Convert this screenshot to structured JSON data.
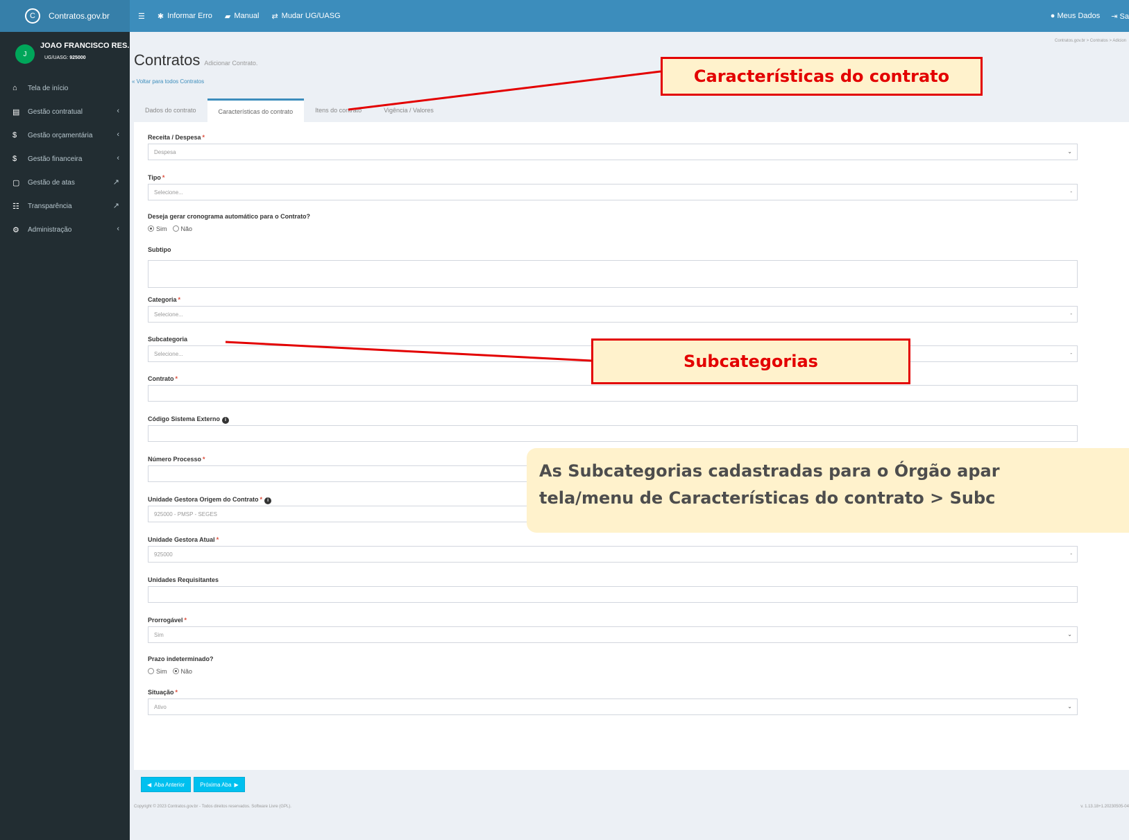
{
  "header": {
    "logo_text": "Contratos.gov.br",
    "nav": [
      "Informar Erro",
      "Manual",
      "Mudar UG/UASG"
    ],
    "meus_dados": "Meus Dados",
    "sair": "Sa"
  },
  "sidebar": {
    "user_name": "JOAO FRANCISCO RES...",
    "user_initial": "J",
    "uasg_label": "UG/UASG:",
    "uasg_value": "925000",
    "items": [
      {
        "label": "Tela de início",
        "icon": "home-icon"
      },
      {
        "label": "Gestão contratual",
        "icon": "document-icon"
      },
      {
        "label": "Gestão orçamentária",
        "icon": "dollar-icon"
      },
      {
        "label": "Gestão financeira",
        "icon": "dollar-icon"
      },
      {
        "label": "Gestão de atas",
        "icon": "file-icon"
      },
      {
        "label": "Transparência",
        "icon": "list-icon"
      },
      {
        "label": "Administração",
        "icon": "cogs-icon"
      }
    ]
  },
  "page": {
    "title": "Contratos",
    "subtitle": "Adicionar Contrato.",
    "back_link": "Voltar para todos Contratos",
    "breadcrumb": "Contratos.gov.br > Contratos > Adicion"
  },
  "tabs": [
    "Dados do contrato",
    "Características do contrato",
    "Itens do contrato",
    "Vigência / Valores"
  ],
  "form": {
    "receita_despesa": {
      "label": "Receita / Despesa",
      "value": "Despesa"
    },
    "tipo": {
      "label": "Tipo",
      "placeholder": "Selecione..."
    },
    "cronograma": {
      "label": "Deseja gerar cronograma automático para o Contrato?",
      "opt1": "Sim",
      "opt2": "Não"
    },
    "subtipo": {
      "label": "Subtipo"
    },
    "categoria": {
      "label": "Categoria",
      "placeholder": "Selecione..."
    },
    "subcategoria": {
      "label": "Subcategoria",
      "placeholder": "Selecione..."
    },
    "contrato": {
      "label": "Contrato"
    },
    "codigo_sistema": {
      "label": "Código Sistema Externo"
    },
    "numero_processo": {
      "label": "Número Processo"
    },
    "ug_origem": {
      "label": "Unidade Gestora Origem do Contrato",
      "value": "925000 - PMSP - SEGES"
    },
    "ug_atual": {
      "label": "Unidade Gestora Atual",
      "value": "925000"
    },
    "unidades_requisitantes": {
      "label": "Unidades Requisitantes"
    },
    "prorrogavel": {
      "label": "Prorrogável",
      "value": "Sim"
    },
    "prazo": {
      "label": "Prazo indeterminado?",
      "opt1": "Sim",
      "opt2": "Não"
    },
    "situacao": {
      "label": "Situação",
      "value": "Ativo"
    },
    "required_mark": "*"
  },
  "buttons": {
    "prev": "Aba Anterior",
    "next": "Próxima Aba"
  },
  "footer": {
    "copyright": "Copyright © 2023 Contratos.gov.br - Todos direitos reservados. Software Livre (GPL).",
    "version": "v. 1.13.18+1.20230505-04"
  },
  "annotations": {
    "callout_tab": "Características do contrato",
    "callout_sub": "Subcategorias",
    "info_line1": "As Subcategorias cadastradas para o Órgão apar",
    "info_line2": "tela/menu de Características do contrato > Subc"
  },
  "colors": {
    "topbar": "#3c8dbc",
    "sidebar": "#222d32",
    "annotation_red": "#e30000",
    "annotation_fill": "#fff2cc",
    "button": "#00c0ef"
  }
}
